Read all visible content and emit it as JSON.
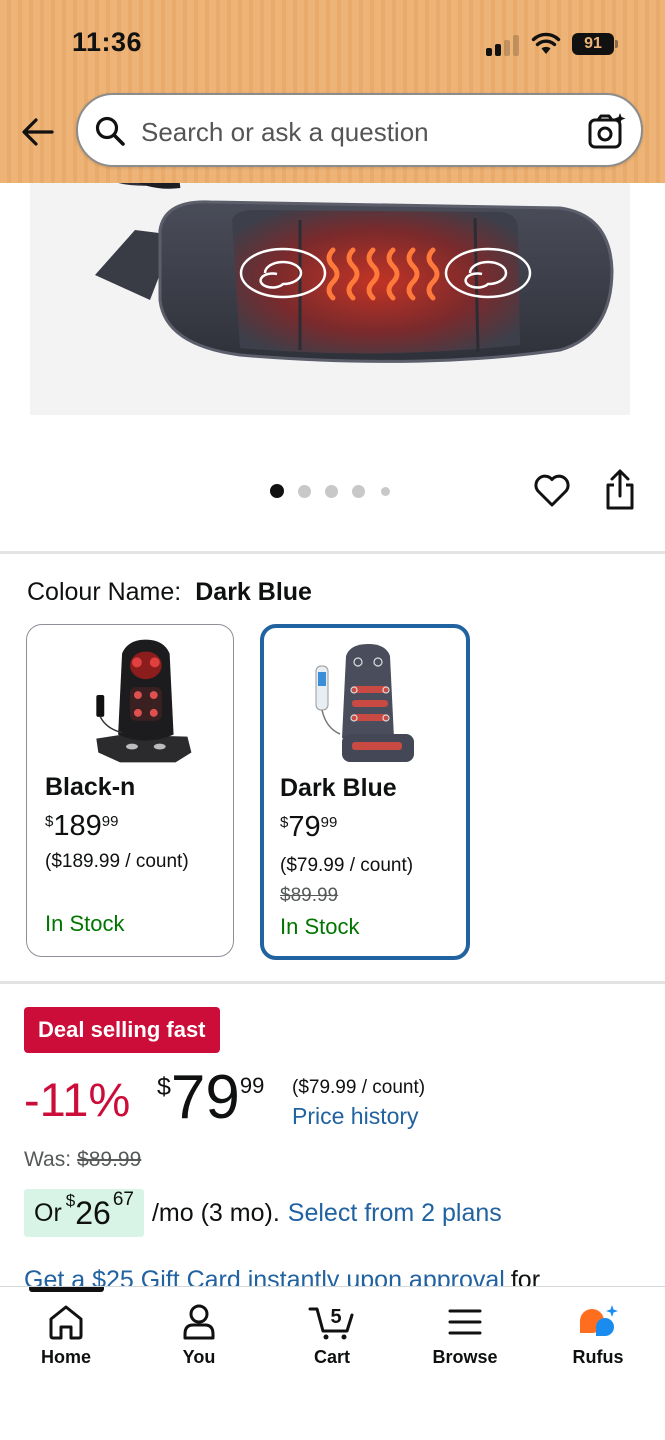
{
  "status_bar": {
    "time": "11:36",
    "battery": "91"
  },
  "search": {
    "placeholder": "Search or ask a question"
  },
  "colour": {
    "label": "Colour Name:",
    "value": "Dark Blue"
  },
  "variants": [
    {
      "name": "Black-n",
      "currency": "$",
      "price_whole": "189",
      "price_cents": "99",
      "unit_price": "($189.99 / count)",
      "was_price": "",
      "stock": "In Stock"
    },
    {
      "name": "Dark Blue",
      "currency": "$",
      "price_whole": "79",
      "price_cents": "99",
      "unit_price": "($79.99 / count)",
      "was_price": "$89.99",
      "stock": "In Stock"
    }
  ],
  "deal": {
    "badge": "Deal selling fast",
    "discount": "-11%",
    "currency": "$",
    "price_whole": "79",
    "price_cents": "99",
    "unit_price": "($79.99 / count)",
    "price_history_link": "Price history",
    "was_label": "Was:",
    "was_price": "$89.99"
  },
  "installment": {
    "prefix": "Or",
    "currency": "$",
    "amount_whole": "26",
    "amount_cents": "67",
    "suffix": "/mo (3 mo).",
    "link": "Select from 2 plans"
  },
  "gift_card": {
    "link": "Get a $25 Gift Card instantly upon approval",
    "tail": "for"
  },
  "carousel": {
    "count": 5,
    "active": 0
  },
  "nav": {
    "items": [
      {
        "label": "Home",
        "icon": "home-icon"
      },
      {
        "label": "You",
        "icon": "person-icon"
      },
      {
        "label": "Cart",
        "icon": "cart-icon",
        "badge": "5"
      },
      {
        "label": "Browse",
        "icon": "menu-icon"
      },
      {
        "label": "Rufus",
        "icon": "rufus-icon"
      }
    ]
  },
  "colors": {
    "deal_red": "#cc0c39",
    "link_blue": "#2162a1",
    "stock_green": "#007600",
    "header": "#eeb477",
    "installment_bg": "#d7f4e6"
  }
}
